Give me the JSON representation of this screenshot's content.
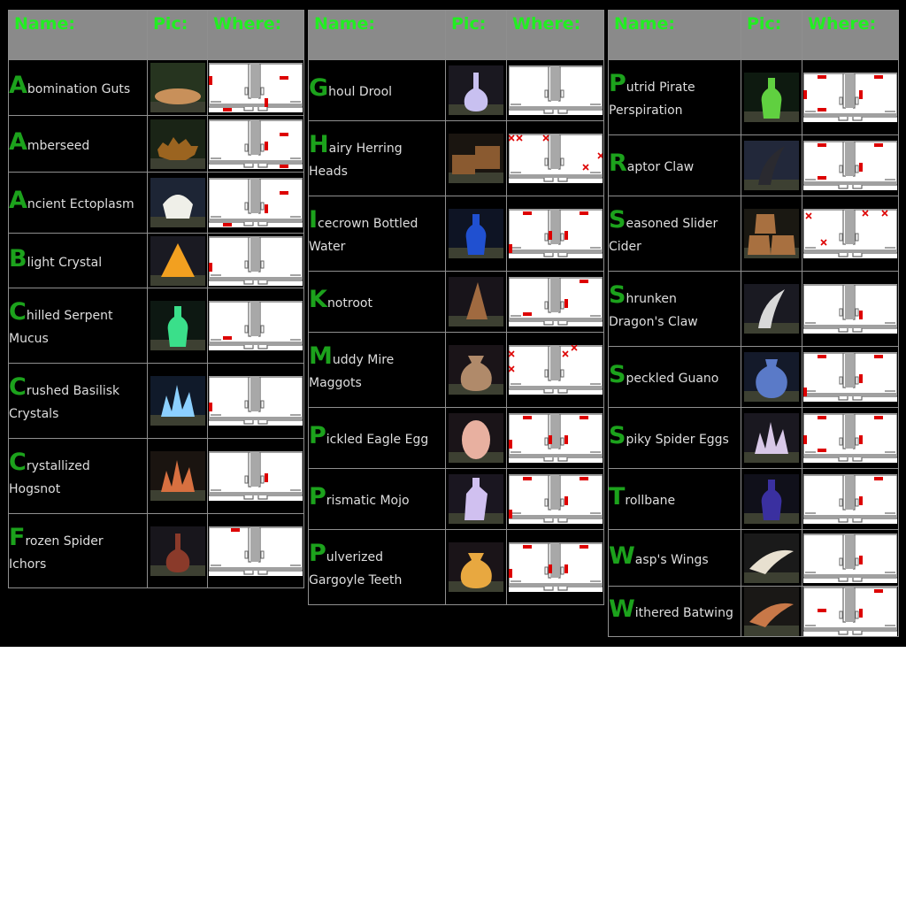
{
  "headers": {
    "name": "Name:",
    "pic": "Pic:",
    "where": "Where:"
  },
  "colors": {
    "header_text": "#22ee22",
    "initial": "#1ca21c",
    "marker": "#dd0000",
    "cross": "#dd0000"
  },
  "columns": [
    {
      "items": [
        {
          "initial": "A",
          "rest_lines": [
            "bomination Guts"
          ],
          "icon": "abomination-guts-icon",
          "pic": {
            "shape": "blob",
            "color": "#c8905a",
            "bg": "#26341f"
          },
          "map": {
            "bars": [
              [
                0,
                15
              ],
              [
                80,
                15
              ],
              [
                63,
                40
              ],
              [
                16,
                51
              ]
            ],
            "crosses": []
          }
        },
        {
          "initial": "A",
          "rest_lines": [
            "mberseed"
          ],
          "icon": "amberseed-icon",
          "pic": {
            "shape": "spiky",
            "color": "#9b6420",
            "bg": "#1a2416"
          },
          "map": {
            "bars": [
              [
                80,
                15
              ],
              [
                63,
                25
              ],
              [
                80,
                51
              ]
            ],
            "crosses": []
          }
        },
        {
          "initial": "A",
          "rest_lines": [
            "ncient Ectoplasm"
          ],
          "icon": "ancient-ectoplasm-icon",
          "pic": {
            "shape": "bowl",
            "color": "#efefe8",
            "bg": "#1d2535"
          },
          "map": {
            "bars": [
              [
                80,
                15
              ],
              [
                63,
                30
              ],
              [
                16,
                51
              ]
            ],
            "crosses": []
          }
        },
        {
          "initial": "B",
          "rest_lines": [
            "light Crystal"
          ],
          "icon": "blight-crystal-icon",
          "pic": {
            "shape": "cone",
            "color": "#f2a020",
            "bg": "#1a1a22"
          },
          "map": {
            "bars": [
              [
                0,
                30
              ]
            ],
            "crosses": []
          }
        },
        {
          "initial": "C",
          "rest_lines": [
            "hilled Serpent",
            "Mucus"
          ],
          "icon": "chilled-serpent-mucus-icon",
          "pic": {
            "shape": "bottle",
            "color": "#3adf8a",
            "bg": "#0d1812"
          },
          "map": {
            "bars": [
              [
                16,
                40
              ]
            ],
            "crosses": []
          }
        },
        {
          "initial": "C",
          "rest_lines": [
            "rushed Basilisk",
            "Crystals"
          ],
          "icon": "crushed-basilisk-crystals-icon",
          "pic": {
            "shape": "crystals",
            "color": "#8cd0ff",
            "bg": "#101a2a"
          },
          "map": {
            "bars": [
              [
                0,
                30
              ]
            ],
            "crosses": []
          }
        },
        {
          "initial": "C",
          "rest_lines": [
            "rystallized",
            "Hogsnot"
          ],
          "icon": "crystallized-hogsnot-icon",
          "pic": {
            "shape": "crystals",
            "color": "#d87040",
            "bg": "#1a1410"
          },
          "map": {
            "bars": [
              [
                63,
                25
              ]
            ],
            "crosses": []
          }
        },
        {
          "initial": "F",
          "rest_lines": [
            "rozen Spider",
            "Ichors"
          ],
          "icon": "frozen-spider-ichors-icon",
          "pic": {
            "shape": "flask",
            "color": "#8a3a2a",
            "bg": "#18161c"
          },
          "map": {
            "bars": [
              [
                25,
                2
              ]
            ],
            "crosses": []
          }
        }
      ]
    },
    {
      "items": [
        {
          "initial": "G",
          "rest_lines": [
            "houl Drool"
          ],
          "icon": "ghoul-drool-icon",
          "pic": {
            "shape": "flask",
            "color": "#c8c0f0",
            "bg": "#1a1820"
          },
          "map": {
            "bars": [],
            "crosses": []
          }
        },
        {
          "initial": "H",
          "rest_lines": [
            "airy Herring",
            "Heads"
          ],
          "icon": "hairy-herring-heads-icon",
          "pic": {
            "shape": "crates",
            "color": "#8a5a30",
            "bg": "#1a1510"
          },
          "map": {
            "bars": [],
            "crosses": [
              [
                3,
                5
              ],
              [
                12,
                5
              ],
              [
                42,
                5
              ],
              [
                87,
                38
              ],
              [
                104,
                25
              ]
            ]
          }
        },
        {
          "initial": "I",
          "rest_lines": [
            "cecrown Bottled",
            "Water"
          ],
          "icon": "icecrown-bottled-water-icon",
          "pic": {
            "shape": "bottle",
            "color": "#2050d0",
            "bg": "#0e1424"
          },
          "map": {
            "bars": [
              [
                16,
                3
              ],
              [
                80,
                3
              ],
              [
                45,
                25
              ],
              [
                63,
                25
              ],
              [
                0,
                40
              ]
            ],
            "crosses": []
          }
        },
        {
          "initial": "K",
          "rest_lines": [
            "notroot"
          ],
          "icon": "knotroot-icon",
          "pic": {
            "shape": "spike",
            "color": "#a06a40",
            "bg": "#18141a"
          },
          "map": {
            "bars": [
              [
                80,
                3
              ],
              [
                63,
                25
              ],
              [
                16,
                40
              ]
            ],
            "crosses": []
          }
        },
        {
          "initial": "M",
          "rest_lines": [
            "uddy Mire",
            "Maggots"
          ],
          "icon": "muddy-mire-maggots-icon",
          "pic": {
            "shape": "sack",
            "color": "#b08a6a",
            "bg": "#1a1418"
          },
          "map": {
            "bars": [],
            "crosses": [
              [
                3,
                10
              ],
              [
                3,
                27
              ],
              [
                64,
                10
              ],
              [
                74,
                3
              ]
            ]
          }
        },
        {
          "initial": "P",
          "rest_lines": [
            "ickled Eagle Egg"
          ],
          "icon": "pickled-eagle-egg-icon",
          "pic": {
            "shape": "egg",
            "color": "#e8b0a0",
            "bg": "#1a1418"
          },
          "map": {
            "bars": [
              [
                16,
                3
              ],
              [
                80,
                3
              ],
              [
                45,
                25
              ],
              [
                63,
                25
              ],
              [
                0,
                30
              ]
            ],
            "crosses": []
          }
        },
        {
          "initial": "P",
          "rest_lines": [
            "rismatic Mojo"
          ],
          "icon": "prismatic-mojo-icon",
          "pic": {
            "shape": "jar",
            "color": "#d0c0f0",
            "bg": "#1a1620"
          },
          "map": {
            "bars": [
              [
                16,
                3
              ],
              [
                80,
                3
              ],
              [
                63,
                25
              ],
              [
                0,
                40
              ]
            ],
            "crosses": []
          }
        },
        {
          "initial": "P",
          "rest_lines": [
            "ulverized",
            "Gargoyle Teeth"
          ],
          "icon": "pulverized-gargoyle-teeth-icon",
          "pic": {
            "shape": "sack",
            "color": "#e8a840",
            "bg": "#1a1418"
          },
          "map": {
            "bars": [
              [
                16,
                3
              ],
              [
                80,
                3
              ],
              [
                45,
                25
              ],
              [
                63,
                25
              ],
              [
                0,
                30
              ]
            ],
            "crosses": []
          }
        }
      ]
    },
    {
      "items": [
        {
          "initial": "P",
          "rest_lines": [
            "utrid Pirate",
            "Perspiration"
          ],
          "icon": "putrid-pirate-perspiration-icon",
          "pic": {
            "shape": "bottle",
            "color": "#60d040",
            "bg": "#0e1a10"
          },
          "map": {
            "bars": [
              [
                16,
                3
              ],
              [
                80,
                3
              ],
              [
                0,
                20
              ],
              [
                63,
                20
              ],
              [
                16,
                40
              ]
            ],
            "crosses": []
          }
        },
        {
          "initial": "R",
          "rest_lines": [
            "aptor Claw"
          ],
          "icon": "raptor-claw-icon",
          "pic": {
            "shape": "claw",
            "color": "#2a2a30",
            "bg": "#22283a"
          },
          "map": {
            "bars": [
              [
                16,
                3
              ],
              [
                80,
                3
              ],
              [
                63,
                25
              ],
              [
                16,
                40
              ]
            ],
            "crosses": []
          }
        },
        {
          "initial": "S",
          "rest_lines": [
            "easoned Slider",
            "Cider"
          ],
          "icon": "seasoned-slider-cider-icon",
          "pic": {
            "shape": "barrels",
            "color": "#a87040",
            "bg": "#1a1812"
          },
          "map": {
            "bars": [],
            "crosses": [
              [
                6,
                8
              ],
              [
                23,
                38
              ],
              [
                70,
                5
              ],
              [
                92,
                5
              ]
            ]
          }
        },
        {
          "initial": "S",
          "rest_lines": [
            "hrunken",
            "Dragon's Claw"
          ],
          "icon": "shrunken-dragons-claw-icon",
          "pic": {
            "shape": "claw",
            "color": "#d8d8d8",
            "bg": "#1a1a22"
          },
          "map": {
            "bars": [
              [
                63,
                30
              ]
            ],
            "crosses": []
          }
        },
        {
          "initial": "S",
          "rest_lines": [
            "peckled Guano"
          ],
          "icon": "speckled-guano-icon",
          "pic": {
            "shape": "vase",
            "color": "#5a7ac8",
            "bg": "#141a2a"
          },
          "map": {
            "bars": [
              [
                16,
                3
              ],
              [
                80,
                3
              ],
              [
                63,
                25
              ],
              [
                0,
                40
              ]
            ],
            "crosses": []
          }
        },
        {
          "initial": "S",
          "rest_lines": [
            "piky Spider Eggs"
          ],
          "icon": "spiky-spider-eggs-icon",
          "pic": {
            "shape": "crystals",
            "color": "#d8c8e8",
            "bg": "#1a1820"
          },
          "map": {
            "bars": [
              [
                16,
                3
              ],
              [
                80,
                3
              ],
              [
                0,
                25
              ],
              [
                63,
                25
              ],
              [
                16,
                40
              ]
            ],
            "crosses": []
          }
        },
        {
          "initial": "T",
          "rest_lines": [
            "rollbane"
          ],
          "icon": "trollbane-icon",
          "pic": {
            "shape": "bottle",
            "color": "#3a30a0",
            "bg": "#10101a"
          },
          "map": {
            "bars": [
              [
                80,
                3
              ],
              [
                63,
                25
              ]
            ],
            "crosses": []
          }
        },
        {
          "initial": "W",
          "rest_lines": [
            "asp's Wings"
          ],
          "icon": "wasps-wings-icon",
          "pic": {
            "shape": "wing",
            "color": "#e8e0d0",
            "bg": "#1a1a1a"
          },
          "map": {
            "bars": [
              [
                63,
                25
              ]
            ],
            "crosses": []
          }
        },
        {
          "initial": "W",
          "rest_lines": [
            "ithered Batwing"
          ],
          "icon": "withered-batwing-icon",
          "pic": {
            "shape": "wing",
            "color": "#c87848",
            "bg": "#1a1816"
          },
          "map": {
            "bars": [
              [
                80,
                3
              ],
              [
                16,
                25
              ],
              [
                63,
                25
              ]
            ],
            "crosses": []
          }
        }
      ]
    }
  ]
}
